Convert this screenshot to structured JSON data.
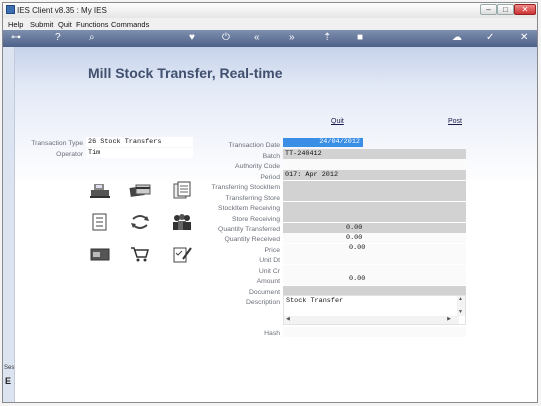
{
  "window": {
    "title": "IES Client v8.35 : My IES",
    "minimize": "–",
    "maximize": "□",
    "close": "✕"
  },
  "menu": [
    "Help",
    "Submit",
    "Quit",
    "Functions",
    "Commands"
  ],
  "toolbar": {
    "icons": [
      "key-icon",
      "help-icon",
      "search-icon",
      "heart-icon",
      "power-icon",
      "rewind-icon",
      "forward-icon",
      "upload-icon",
      "stop-icon",
      "cloud-icon",
      "check-icon",
      "close-icon"
    ],
    "glyphs": [
      "⊶",
      "?",
      "⌕",
      "♥",
      "⏻",
      "«",
      "»",
      "⇡",
      "■",
      "☁",
      "✓",
      "✕"
    ]
  },
  "page": {
    "title": "Mill Stock Transfer, Real-time",
    "quit": "Quit",
    "post": "Post"
  },
  "left": {
    "transaction_type_label": "Transaction Type",
    "transaction_type_value": "26 Stock Transfers",
    "operator_label": "Operator",
    "operator_value": "Tim"
  },
  "form": {
    "transaction_date": {
      "label": "Transaction Date",
      "value": "24/04/2012"
    },
    "batch": {
      "label": "Batch",
      "value": "TT-240412"
    },
    "authority_code": {
      "label": "Authority Code",
      "value": ""
    },
    "period": {
      "label": "Period",
      "value": "017: Apr 2012"
    },
    "transferring_stockitem": {
      "label": "Transferring StockItem",
      "value": ""
    },
    "transferring_store": {
      "label": "Transferring Store",
      "value": ""
    },
    "stockitem_receiving": {
      "label": "StockItem Receiving",
      "value": ""
    },
    "store_receiving": {
      "label": "Store Receiving",
      "value": ""
    },
    "quantity_transferred": {
      "label": "Quantity Transferred",
      "value": "0.00"
    },
    "quantity_received": {
      "label": "Quantity Received",
      "value": "0.00"
    },
    "price": {
      "label": "Price",
      "value": "0.00"
    },
    "unit_dt": {
      "label": "Unit Dt",
      "value": ""
    },
    "unit_cr": {
      "label": "Unit Cr",
      "value": ""
    },
    "amount": {
      "label": "Amount",
      "value": "0.00"
    },
    "document": {
      "label": "Document",
      "value": ""
    },
    "description": {
      "label": "Description",
      "value": "Stock Transfer"
    },
    "hash": {
      "label": "Hash",
      "value": ""
    }
  },
  "sidebar": {
    "top": "Ses",
    "bottom": "E"
  },
  "colors": {
    "selected_field": "#3a8ee6",
    "readonly_field": "#d2d2d2",
    "toolbar": "#5a6c92",
    "heading": "#40506e"
  }
}
